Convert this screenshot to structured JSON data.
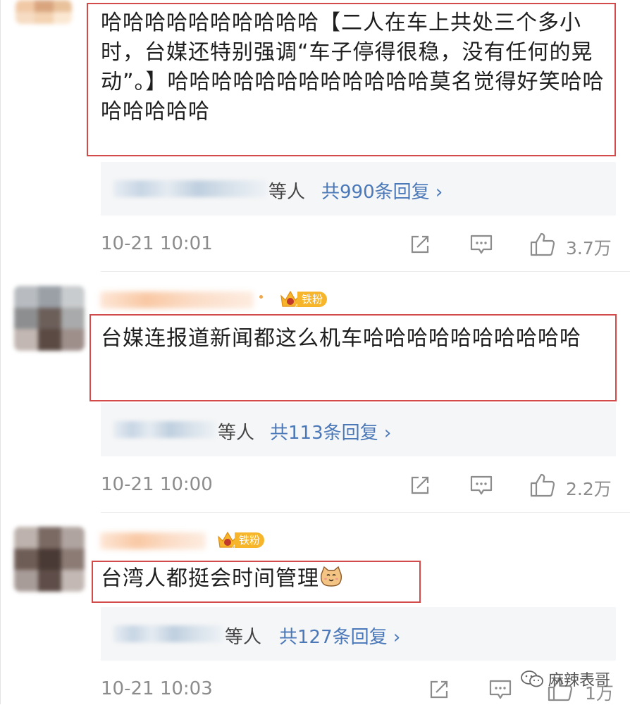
{
  "comments": [
    {
      "text": "哈哈哈哈哈哈哈哈哈哈【二人在车上共处三个多小时，台媒还特别强调“车子停得很稳，没有任何的晃动”。】哈哈哈哈哈哈哈哈哈哈哈哈莫名觉得好笑哈哈哈哈哈哈哈",
      "reply_etc": "等人",
      "reply_link": "共990条回复 ›",
      "time": "10-21 10:01",
      "likes": "3.7万"
    },
    {
      "badge": "铁粉",
      "text": "台媒连报道新闻都这么机车哈哈哈哈哈哈哈哈哈哈",
      "reply_etc": "等人",
      "reply_link": "共113条回复 ›",
      "time": "10-21 10:00",
      "likes": "2.2万"
    },
    {
      "badge": "铁粉",
      "text": "台湾人都挺会时间管理",
      "reply_etc": "等人",
      "reply_link": "共127条回复 ›",
      "time": "10-21 10:03",
      "likes": "1万"
    }
  ],
  "badge_level": "4",
  "watermark": "麻辣表哥",
  "icons": [
    "share-icon",
    "comment-icon",
    "like-icon",
    "cat-emoji-icon",
    "crown-icon",
    "wechat-icon"
  ],
  "colors": {
    "highlight_box": "#d24a4a",
    "link": "#4a78b8",
    "badge": "#f7b52c",
    "meta": "#8c8c8c",
    "reply_bg": "#f5f6f7"
  }
}
